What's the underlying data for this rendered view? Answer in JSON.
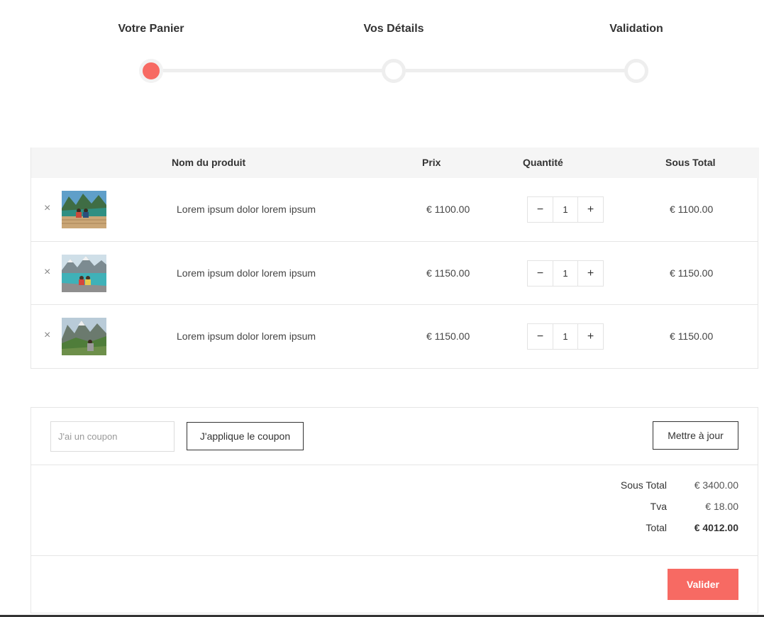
{
  "stepper": {
    "steps": [
      {
        "label": "Votre Panier",
        "active": true
      },
      {
        "label": "Vos Détails",
        "active": false
      },
      {
        "label": "Validation",
        "active": false
      }
    ],
    "active_color": "#f76a63"
  },
  "cart": {
    "columns": {
      "product": "Nom du produit",
      "price": "Prix",
      "quantity": "Quantité",
      "subtotal": "Sous Total"
    },
    "remove_icon": "×",
    "decrement_icon": "−",
    "increment_icon": "+",
    "items": [
      {
        "name": "Lorem ipsum dolor lorem ipsum",
        "price": "€ 1100.00",
        "quantity": "1",
        "subtotal": "€ 1100.00",
        "thumbnail": "lake-dock-photo"
      },
      {
        "name": "Lorem ipsum dolor lorem ipsum",
        "price": "€ 1150.00",
        "quantity": "1",
        "subtotal": "€ 1150.00",
        "thumbnail": "mountain-lake-photo"
      },
      {
        "name": "Lorem ipsum dolor lorem ipsum",
        "price": "€ 1150.00",
        "quantity": "1",
        "subtotal": "€ 1150.00",
        "thumbnail": "mountain-valley-photo"
      }
    ]
  },
  "coupon": {
    "placeholder": "J'ai un coupon",
    "apply_label": "J'applique le coupon",
    "update_label": "Mettre à jour"
  },
  "summary": {
    "subtotal_label": "Sous Total",
    "subtotal_value": "€ 3400.00",
    "tax_label": "Tva",
    "tax_value": "€ 18.00",
    "total_label": "Total",
    "total_value": "€ 4012.00"
  },
  "checkout": {
    "validate_label": "Valider"
  }
}
